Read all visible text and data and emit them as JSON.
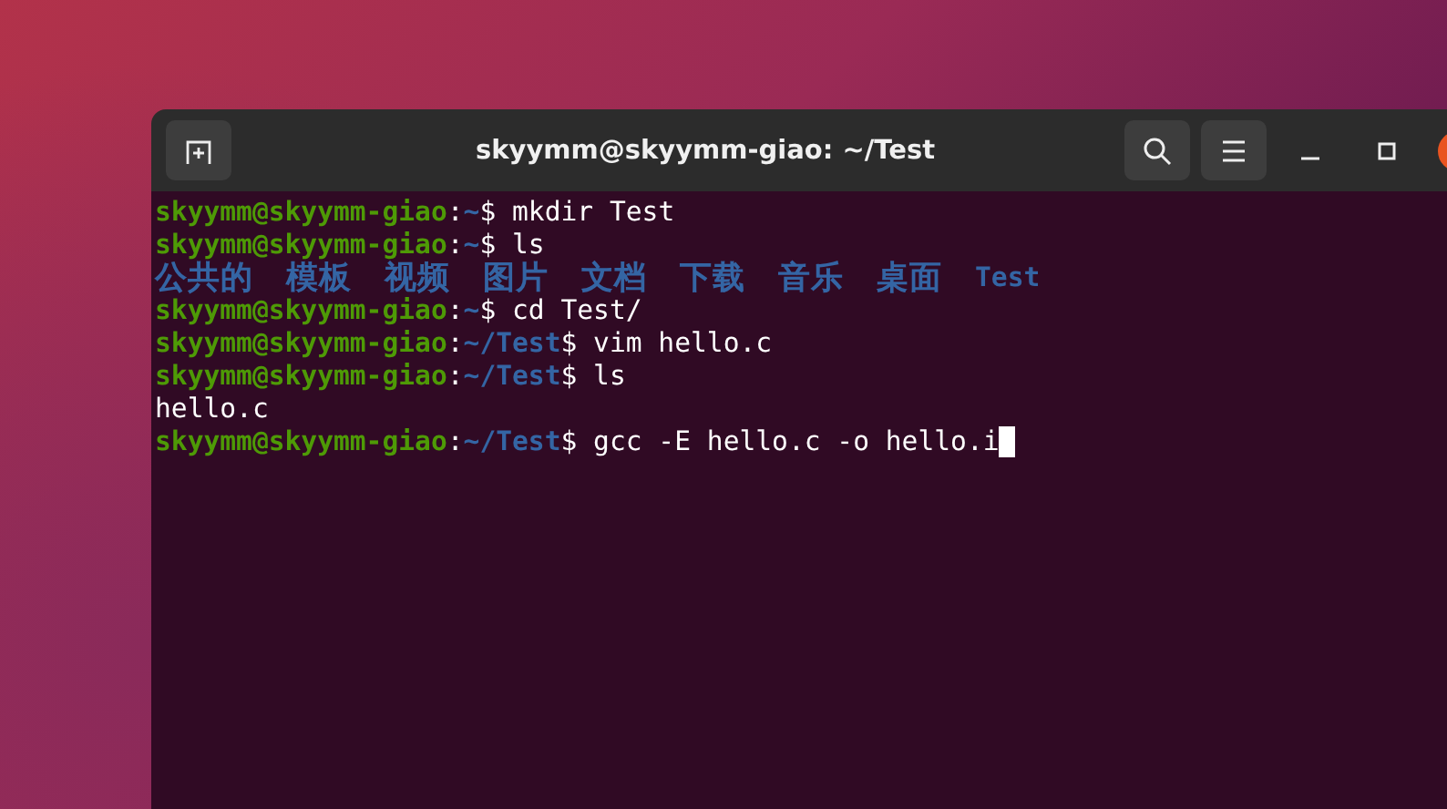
{
  "window": {
    "title": "skyymm@skyymm-giao: ~/Test"
  },
  "terminal": {
    "lines": [
      {
        "kind": "prompt",
        "user": "skyymm@skyymm-giao",
        "separator": ":",
        "path": "~",
        "symbol": "$",
        "command": "mkdir Test",
        "cursor": false
      },
      {
        "kind": "prompt",
        "user": "skyymm@skyymm-giao",
        "separator": ":",
        "path": "~",
        "symbol": "$",
        "command": "ls",
        "cursor": false
      },
      {
        "kind": "listing",
        "entries": [
          {
            "name": "公共的",
            "kind": "dir"
          },
          {
            "name": "模板",
            "kind": "dir"
          },
          {
            "name": "视频",
            "kind": "dir"
          },
          {
            "name": "图片",
            "kind": "dir"
          },
          {
            "name": "文档",
            "kind": "dir"
          },
          {
            "name": "下载",
            "kind": "dir"
          },
          {
            "name": "音乐",
            "kind": "dir"
          },
          {
            "name": "桌面",
            "kind": "dir"
          },
          {
            "name": "Test",
            "kind": "dir"
          }
        ]
      },
      {
        "kind": "prompt",
        "user": "skyymm@skyymm-giao",
        "separator": ":",
        "path": "~",
        "symbol": "$",
        "command": "cd Test/",
        "cursor": false
      },
      {
        "kind": "prompt",
        "user": "skyymm@skyymm-giao",
        "separator": ":",
        "path": "~/Test",
        "symbol": "$",
        "command": "vim hello.c",
        "cursor": false
      },
      {
        "kind": "prompt",
        "user": "skyymm@skyymm-giao",
        "separator": ":",
        "path": "~/Test",
        "symbol": "$",
        "command": "ls",
        "cursor": false
      },
      {
        "kind": "output",
        "text": "hello.c"
      },
      {
        "kind": "prompt",
        "user": "skyymm@skyymm-giao",
        "separator": ":",
        "path": "~/Test",
        "symbol": "$",
        "command": "gcc -E hello.c -o hello.i",
        "cursor": true
      }
    ]
  }
}
